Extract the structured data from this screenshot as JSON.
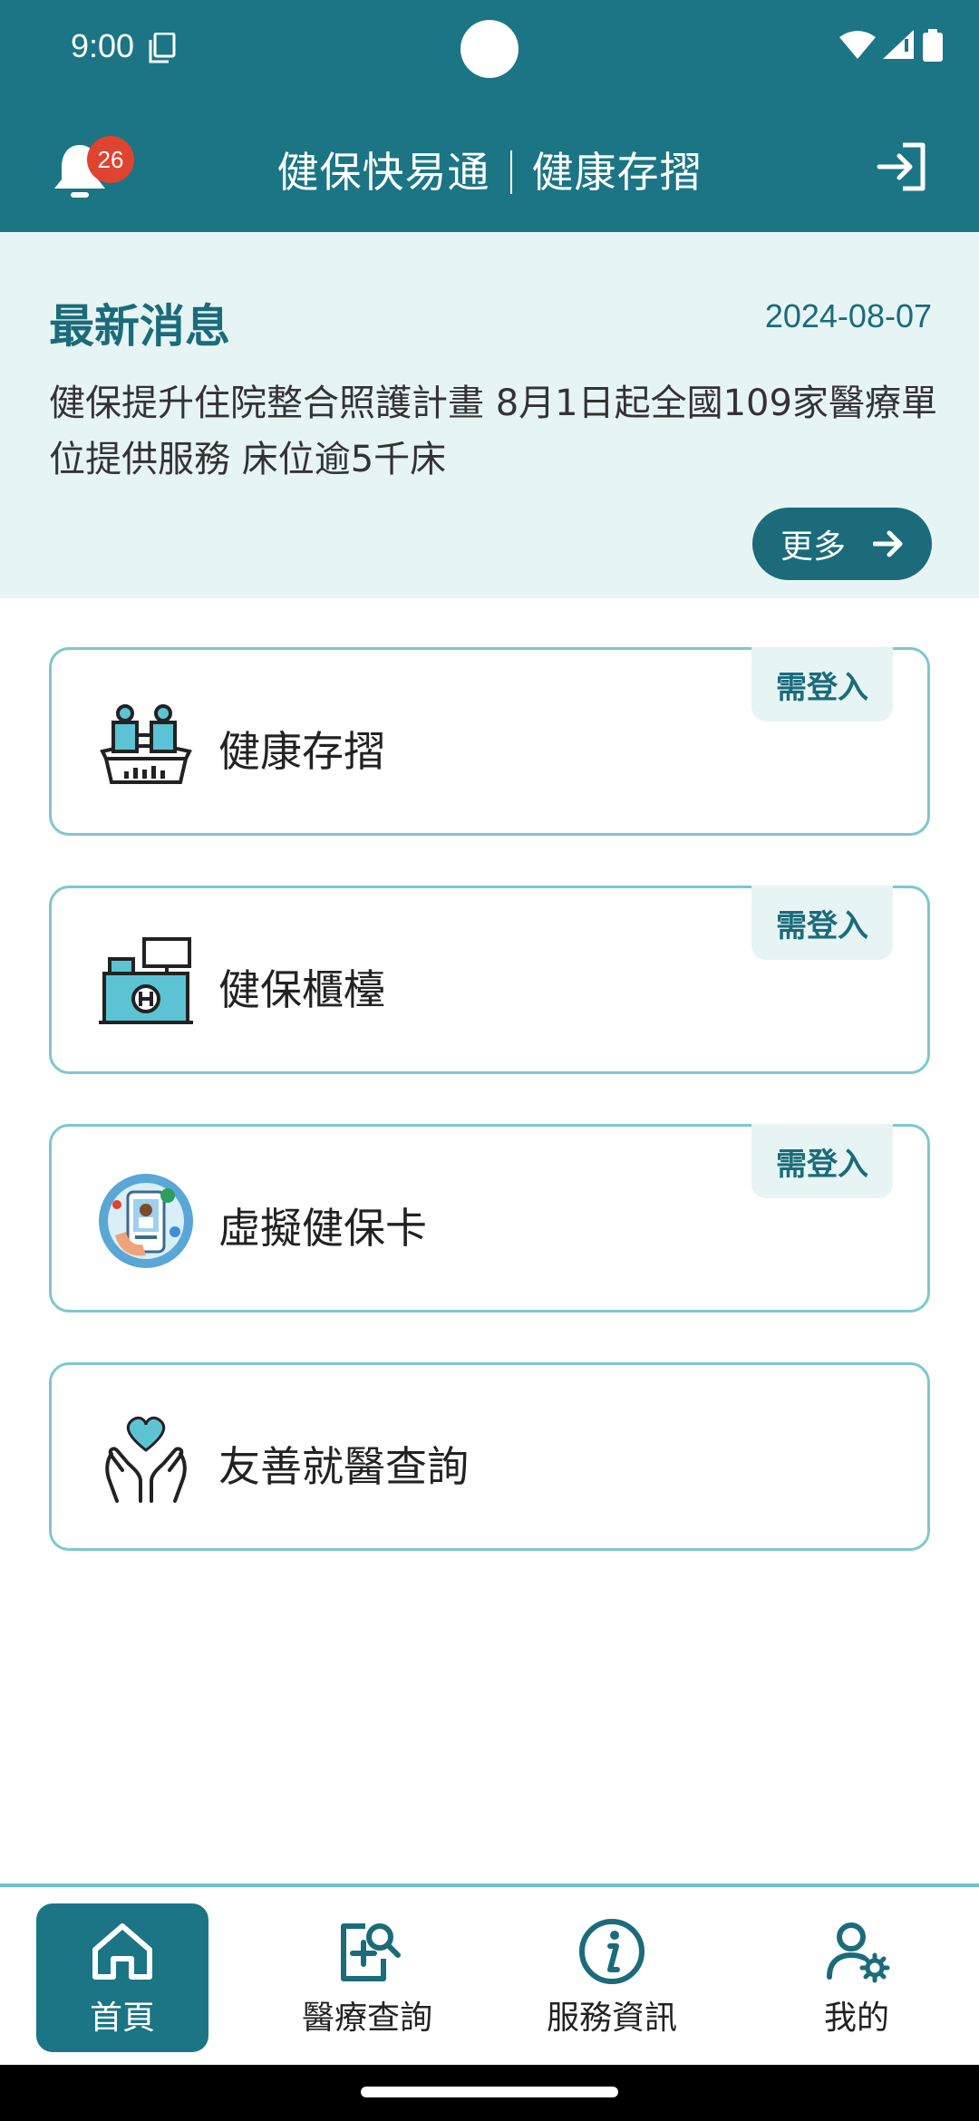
{
  "status_bar": {
    "time": "9:00"
  },
  "app_bar": {
    "title_left": "健保快易通",
    "title_right": "健康存摺",
    "notification_count": "26"
  },
  "news": {
    "heading": "最新消息",
    "date": "2024-08-07",
    "body": "健保提升住院整合照護計畫 8月1日起全國109家醫療單位提供服務 床位逾5千床",
    "more_label": "更多"
  },
  "cards": [
    {
      "label": "健康存摺",
      "tag": "需登入",
      "icon": "health-passbook-icon"
    },
    {
      "label": "健保櫃檯",
      "tag": "需登入",
      "icon": "service-counter-icon"
    },
    {
      "label": "虛擬健保卡",
      "tag": "需登入",
      "icon": "virtual-card-icon"
    },
    {
      "label": "友善就醫查詢",
      "tag": "",
      "icon": "heart-hands-icon"
    }
  ],
  "bottom_nav": [
    {
      "label": "首頁",
      "icon": "home-icon",
      "active": true
    },
    {
      "label": "醫療查詢",
      "icon": "medical-search-icon",
      "active": false
    },
    {
      "label": "服務資訊",
      "icon": "info-icon",
      "active": false
    },
    {
      "label": "我的",
      "icon": "user-settings-icon",
      "active": false
    }
  ],
  "colors": {
    "primary": "#1b7585",
    "accent_light": "#e6f5f3",
    "badge": "#e0432f",
    "border": "#7dc7d3"
  }
}
